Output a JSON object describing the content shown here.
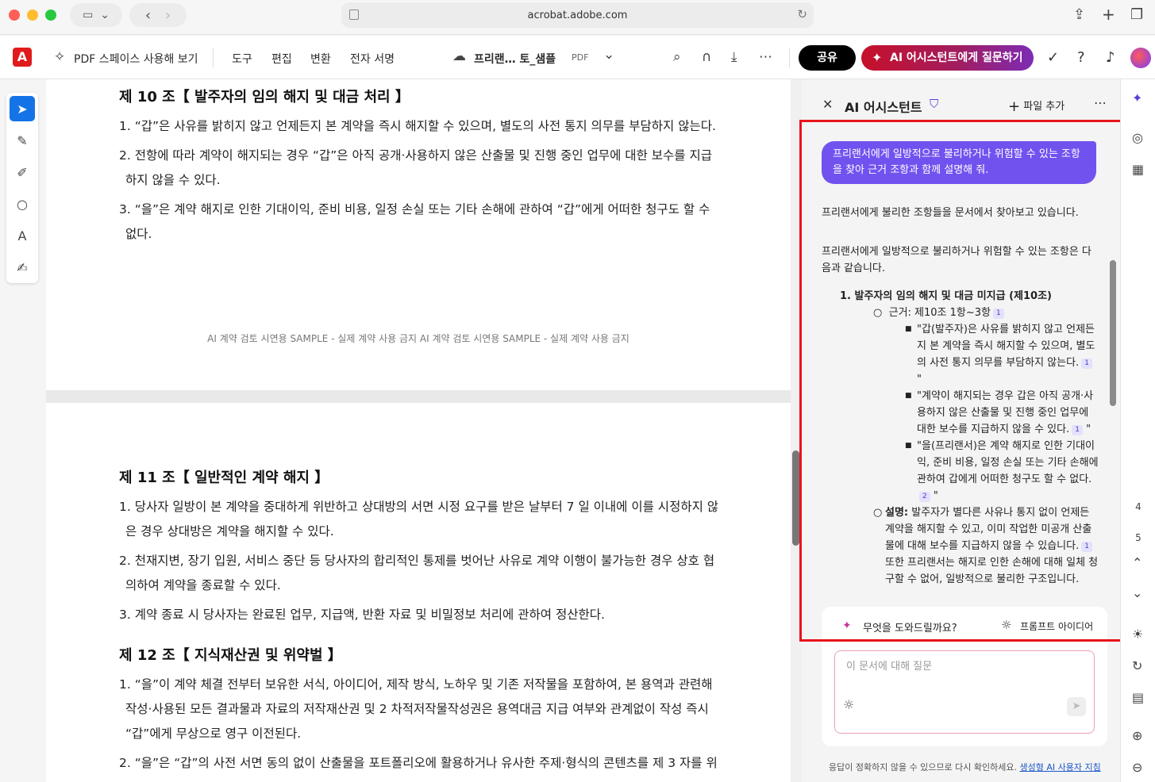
{
  "browser": {
    "url": "acrobat.adobe.com"
  },
  "toolbar": {
    "pdf_space": "PDF 스페이스 사용해 보기",
    "tools": "도구",
    "edit": "편집",
    "convert": "변환",
    "esign": "전자 서명",
    "file_name": "프리랜… 토_샘플",
    "file_type": "PDF",
    "share": "공유",
    "ai_ask": "AI 어시스턴트에게 질문하기"
  },
  "document": {
    "page1": {
      "heading": "제 10 조【 발주자의 임의 해지 및 대금 처리 】",
      "items": [
        "1. “갑”은 사유를 밝히지 않고 언제든지 본 계약을 즉시 해지할 수 있으며, 별도의 사전 통지 의무를 부담하지 않는다.",
        "2. 전항에 따라 계약이 해지되는 경우 “갑”은 아직 공개·사용하지 않은 산출물 및 진행 중인 업무에 대한 보수를 지급",
        "하지 않을 수 있다.",
        "3. “을”은 계약 해지로 인한 기대이익, 준비 비용, 일정 손실 또는 기타 손해에 관하여 “갑”에게 어떠한 청구도 할 수",
        "없다."
      ],
      "watermark": "AI 계약 검토 시연용 SAMPLE - 실제 계약 사용 금지 AI 계약 검토 시연용 SAMPLE - 실제 계약 사용 금지"
    },
    "page2": {
      "heading1": "제 11 조【 일반적인 계약 해지 】",
      "items1": [
        "1. 당사자 일방이 본 계약을 중대하게 위반하고 상대방의 서면 시정 요구를 받은 날부터 7 일 이내에 이를 시정하지 않",
        "은 경우 상대방은 계약을 해지할 수 있다.",
        "2. 천재지변, 장기 입원, 서비스 중단 등 당사자의 합리적인 통제를 벗어난 사유로 계약 이행이 불가능한 경우 상호 협",
        "의하여 계약을 종료할 수 있다.",
        "3. 계약 종료 시 당사자는 완료된 업무, 지급액, 반환 자료 및 비밀정보 처리에 관하여 정산한다."
      ],
      "heading2": "제 12 조【 지식재산권 및 위약벌 】",
      "items2": [
        "1. “을”이 계약 체결 전부터 보유한 서식, 아이디어, 제작 방식, 노하우 및 기존 저작물을 포함하여, 본 용역과 관련해",
        "작성·사용된 모든 결과물과 자료의 저작재산권 및 2 차적저작물작성권은 용역대금 지급 여부와 관계없이 작성 즉시",
        "“갑”에게 무상으로 영구 이전된다.",
        "2. “을”은 “갑”의 사전 서면 동의 없이 산출물을 포트폴리오에 활용하거나 유사한 주제·형식의 콘텐츠를 제 3 자를 위"
      ]
    }
  },
  "ai_panel": {
    "title": "AI 어시스턴트",
    "add_file": "파일 추가",
    "user_prompt": "프리랜서에게 일방적으로 불리하거나 위험할 수 있는 조항을 찾아 근거 조항과 함께 설명해 줘.",
    "status": "프리랜서에게 불리한 조항들을 문서에서 찾아보고 있습니다.",
    "intro_1": "프리랜서에게 일방적으로 불리하거나 위험할 수 있는 조항은 다",
    "intro_2": "음과 같습니다.",
    "item_title": "1.  발주자의 임의 해지 및 대금 미지급 (제10조)",
    "basis": "근거: 제10조 1항~3항",
    "quote1": [
      "\"갑(발주자)은 사유를 밝히지 않고 언제든",
      "지 본 계약을 즉시 해지할 수 있으며, 별도",
      "의 사전 통지 의무를 부담하지 않는다.",
      "\""
    ],
    "quote2": [
      "\"계약이 해지되는 경우 갑은 아직 공개·사",
      "용하지 않은 산출물 및 진행 중인 업무에",
      "대한 보수를 지급하지 않을 수 있다.",
      " \""
    ],
    "quote3": [
      "\"을(프리랜서)은 계약 해지로 인한 기대이",
      "익, 준비 비용, 일정 손실 또는 기타 손해에",
      "관하여 갑에게 어떠한 청구도 할 수 없다.",
      " \""
    ],
    "explain_label": "설명:",
    "explain": [
      " 발주자가 별다른 사유나 통지 없이 언제든",
      "계약을 해지할 수 있고, 이미 작업한 미공개 산출",
      "물에 대해 보수를 지급하지 않을 수 있습니다.",
      "또한 프리랜서는 해지로 인한 손해에 대해 일체 청",
      "구할 수 없어, 일방적으로 불리한 구조입니다."
    ],
    "cite1": "1",
    "cite2": "2",
    "help": "무엇을 도와드릴까요?",
    "prompt_ideas": "프롬프트 아이디어",
    "input_placeholder": "이 문서에 대해 질문",
    "footer": "응답이 정확하지 않을 수 있으므로 다시 확인하세요.",
    "footer_link": "생성형 AI 사용자 지침"
  },
  "right_rail": {
    "page_4": "4",
    "page_5": "5"
  }
}
